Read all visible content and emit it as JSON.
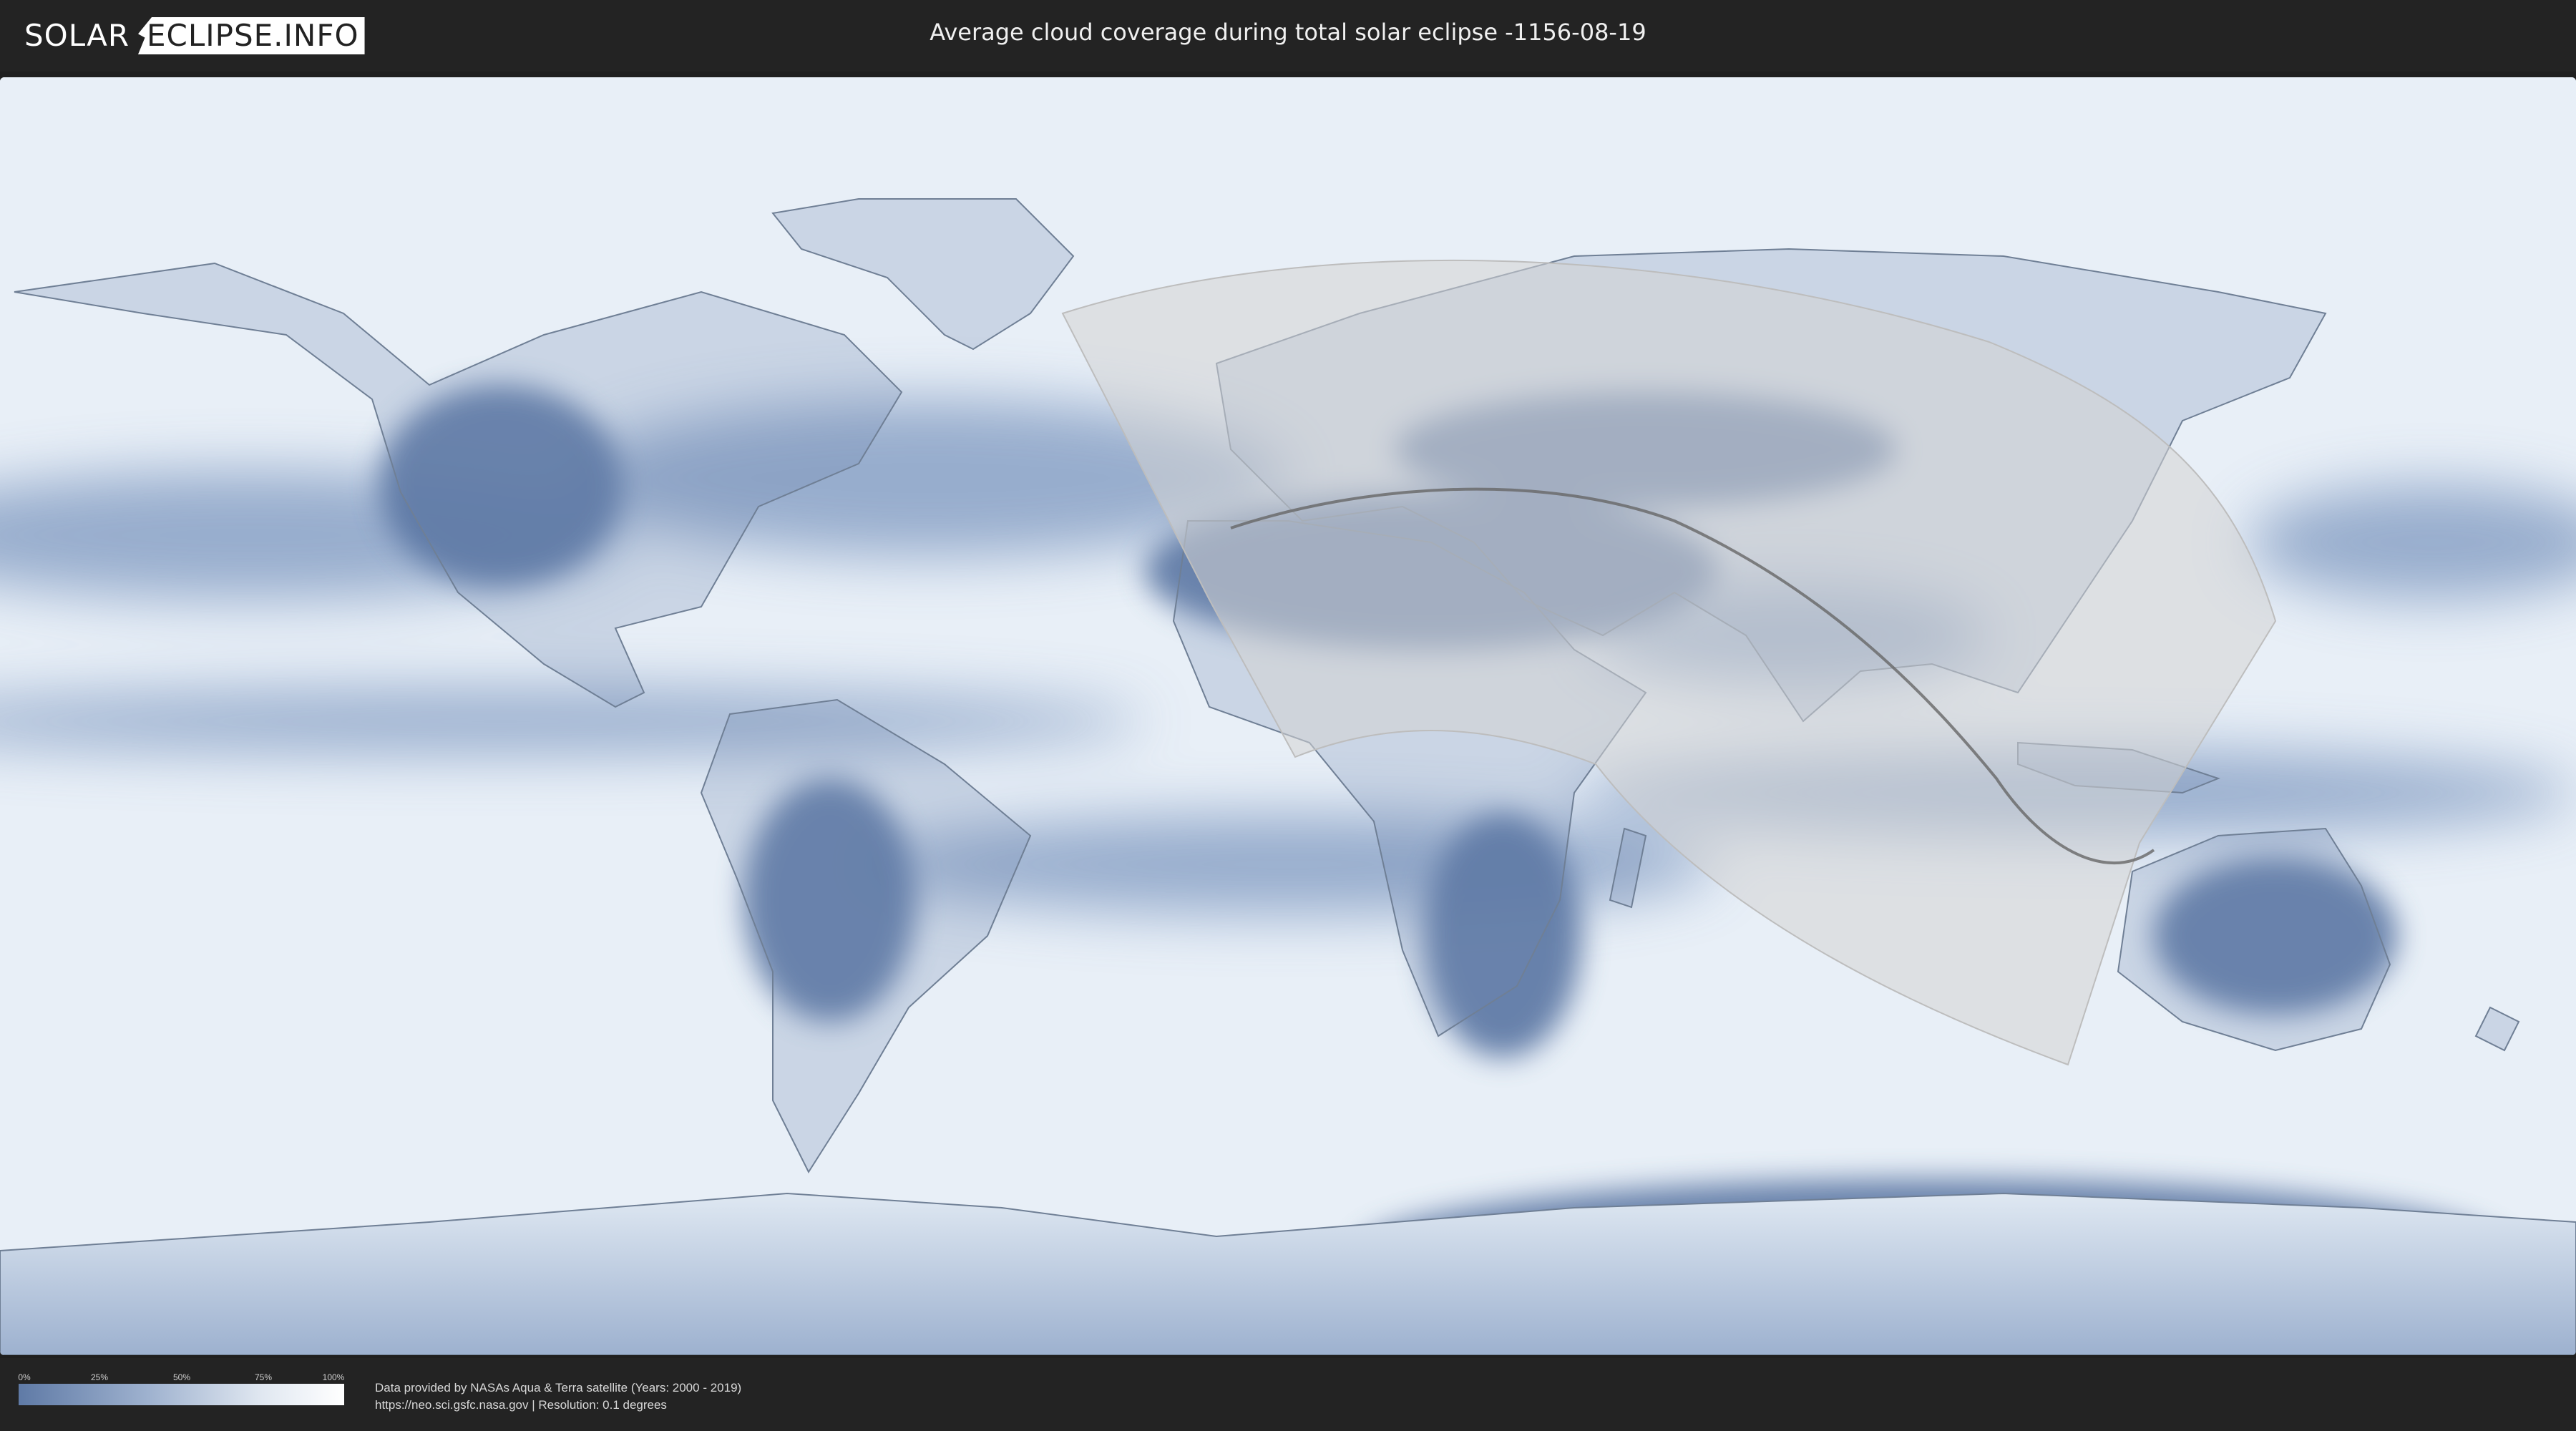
{
  "header": {
    "logo_part1": "SOLAR",
    "logo_part2": "ECLIPSE.INFO",
    "title": "Average cloud coverage during total solar eclipse -1156-08-19"
  },
  "legend": {
    "ticks": [
      "0%",
      "25%",
      "50%",
      "75%",
      "100%"
    ],
    "colors": [
      "#5f7aa6",
      "#9fb2cf",
      "#e1e8f1",
      "#ffffff"
    ]
  },
  "footer": {
    "line1": "Data provided by NASAs Aqua & Terra satellite (Years: 2000 - 2019)",
    "line2": "https://neo.sci.gsfc.nasa.gov | Resolution: 0.1 degrees"
  },
  "map": {
    "ocean_color": "#e6eef7",
    "cloud_low_color": "#5a76a3",
    "land_outline_color": "#6f7f95",
    "eclipse_zone_color": "#d9d9d9",
    "eclipse_path_color": "#666666"
  }
}
